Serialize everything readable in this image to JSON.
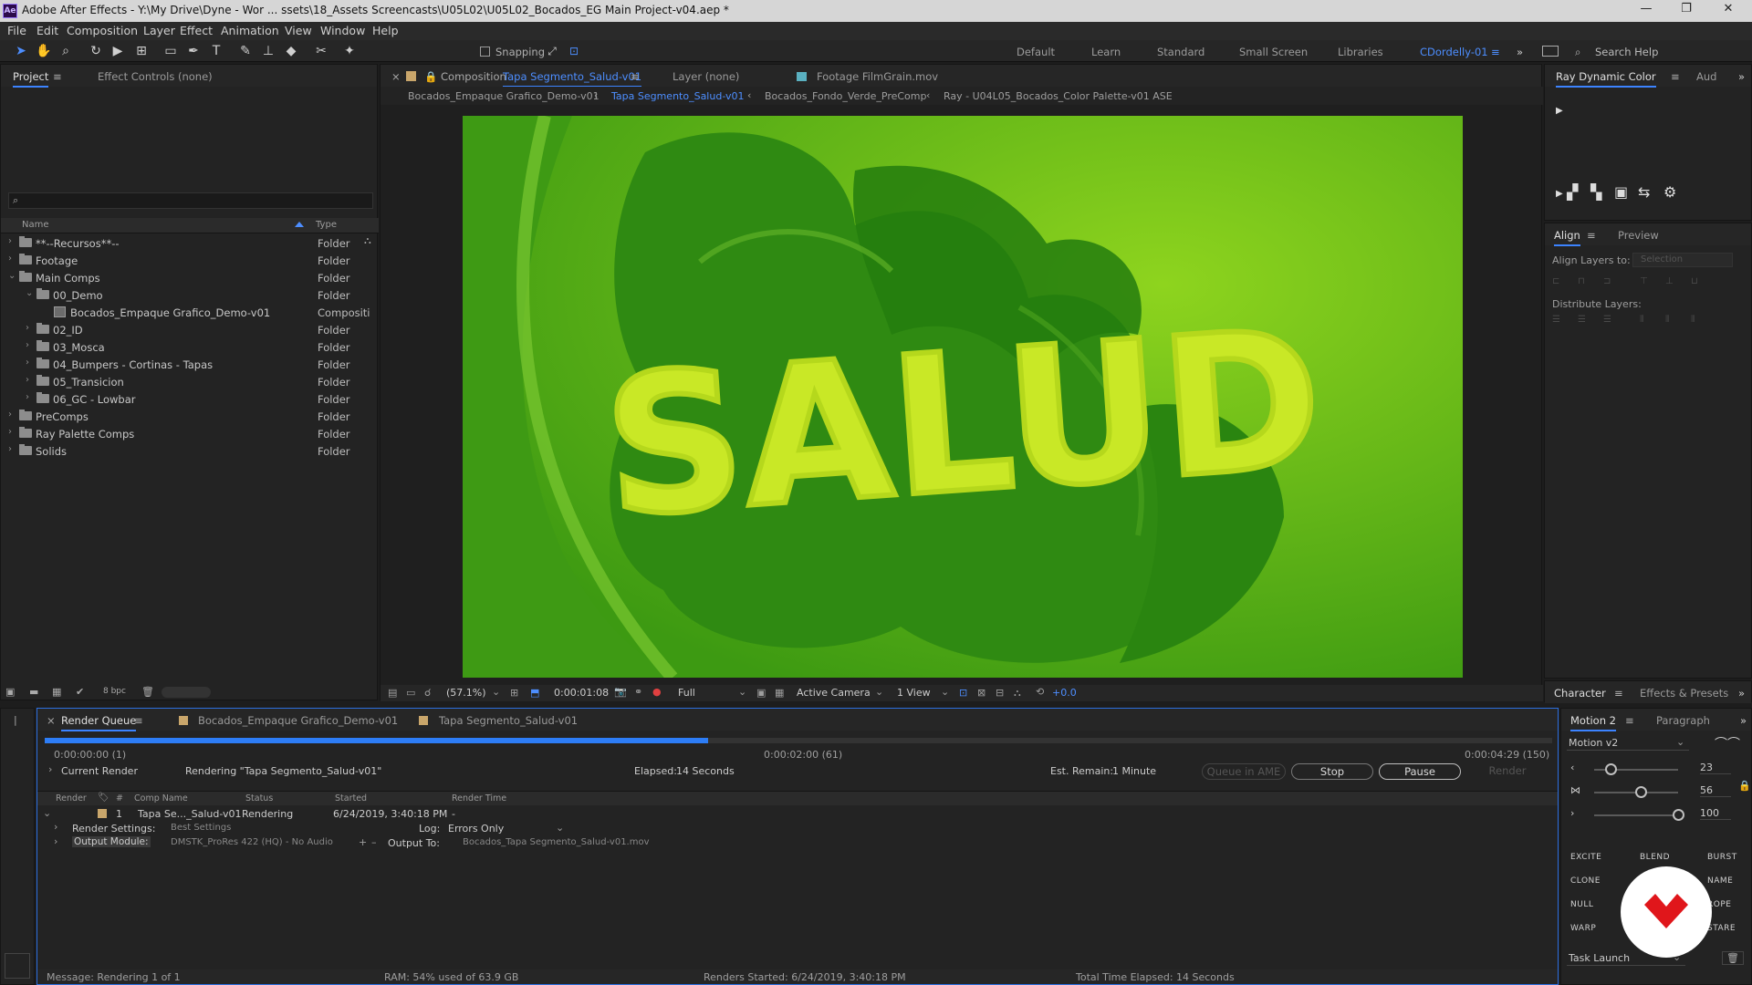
{
  "app": {
    "title": "Adobe After Effects - Y:\\My Drive\\Dyne - Wor ... ssets\\18_Assets Screencasts\\U05L02\\U05L02_Bocados_EG Main Project-v04.aep *",
    "logo": "Ae"
  },
  "menu": [
    "File",
    "Edit",
    "Composition",
    "Layer",
    "Effect",
    "Animation",
    "View",
    "Window",
    "Help"
  ],
  "toolbar": {
    "snapping": "Snapping",
    "workspaces": [
      "Default",
      "Learn",
      "Standard",
      "Small Screen",
      "Libraries",
      "CDordelly-01"
    ],
    "search": "Search Help"
  },
  "project": {
    "tabs": [
      "Project",
      "Effect Controls (none)"
    ],
    "columns": {
      "name": "Name",
      "type": "Type"
    },
    "bpc": "8 bpc",
    "items": [
      {
        "name": "**--Recursos**--",
        "type": "Folder",
        "indent": 0,
        "open": false,
        "kind": "folder"
      },
      {
        "name": "Footage",
        "type": "Folder",
        "indent": 0,
        "open": false,
        "kind": "folder"
      },
      {
        "name": "Main Comps",
        "type": "Folder",
        "indent": 0,
        "open": true,
        "kind": "folder"
      },
      {
        "name": "00_Demo",
        "type": "Folder",
        "indent": 1,
        "open": true,
        "kind": "folder"
      },
      {
        "name": "Bocados_Empaque Grafico_Demo-v01",
        "type": "Compositi",
        "indent": 2,
        "open": null,
        "kind": "comp"
      },
      {
        "name": "02_ID",
        "type": "Folder",
        "indent": 1,
        "open": false,
        "kind": "folder"
      },
      {
        "name": "03_Mosca",
        "type": "Folder",
        "indent": 1,
        "open": false,
        "kind": "folder"
      },
      {
        "name": "04_Bumpers - Cortinas - Tapas",
        "type": "Folder",
        "indent": 1,
        "open": false,
        "kind": "folder"
      },
      {
        "name": "05_Transicion",
        "type": "Folder",
        "indent": 1,
        "open": false,
        "kind": "folder"
      },
      {
        "name": "06_GC - Lowbar",
        "type": "Folder",
        "indent": 1,
        "open": false,
        "kind": "folder"
      },
      {
        "name": "PreComps",
        "type": "Folder",
        "indent": 0,
        "open": false,
        "kind": "folder"
      },
      {
        "name": "Ray Palette Comps",
        "type": "Folder",
        "indent": 0,
        "open": false,
        "kind": "folder"
      },
      {
        "name": "Solids",
        "type": "Folder",
        "indent": 0,
        "open": false,
        "kind": "folder"
      }
    ]
  },
  "viewer": {
    "tab_comp_prefix": "Composition",
    "tab_comp_name": "Tapa Segmento_Salud-v01",
    "tab_layer": "Layer (none)",
    "tab_footage": "Footage FilmGrain.mov",
    "breadcrumbs": [
      "Bocados_Empaque Grafico_Demo-v01",
      "Tapa Segmento_Salud-v01",
      "Bocados_Fondo_Verde_PreComp",
      "Ray - U04L05_Bocados_Color Palette-v01 ASE"
    ],
    "artwork_text": "SALUD",
    "zoom": "(57.1%)",
    "timecode": "0:00:01:08",
    "resolution": "Full",
    "camera": "Active Camera",
    "views": "1 View",
    "exposure": "+0.0"
  },
  "right": {
    "ray_tab": "Ray Dynamic Color",
    "aud_tab": "Aud",
    "align_tab": "Align",
    "preview_tab": "Preview",
    "align_to_label": "Align Layers to:",
    "align_to_value": "Selection",
    "distribute_label": "Distribute Layers:",
    "character_tab": "Character",
    "effects_tab": "Effects & Presets"
  },
  "render_queue": {
    "tabs": [
      "Render Queue",
      "Bocados_Empaque Grafico_Demo-v01",
      "Tapa Segmento_Salud-v01"
    ],
    "time_start": "0:00:00:00 (1)",
    "time_mid": "0:00:02:00 (61)",
    "time_end": "0:00:04:29 (150)",
    "progress": 0.44,
    "current_render_label": "Current Render",
    "current_render_value": "Rendering \"Tapa Segmento_Salud-v01\"",
    "elapsed_label": "Elapsed:",
    "elapsed_value": "14 Seconds",
    "remain_label": "Est. Remain:",
    "remain_value": "1 Minute",
    "buttons": {
      "queue_ame": "Queue in AME",
      "stop": "Stop",
      "pause": "Pause",
      "render": "Render"
    },
    "columns": [
      "Render",
      "#",
      "Comp Name",
      "Status",
      "Started",
      "Render Time"
    ],
    "item": {
      "num": "1",
      "comp": "Tapa Se..._Salud-v01",
      "status": "Rendering",
      "started": "6/24/2019, 3:40:18 PM",
      "render_time": "-",
      "settings_label": "Render Settings:",
      "settings_value": "Best Settings",
      "log_label": "Log:",
      "log_value": "Errors Only",
      "output_label": "Output Module:",
      "output_value": "DMSTK_ProRes 422 (HQ) - No Audio",
      "output_to_label": "Output To:",
      "output_to_value": "Bocados_Tapa Segmento_Salud-v01.mov"
    },
    "status": {
      "message": "Message: Rendering 1 of 1",
      "ram": "RAM: 54% used of 63.9 GB",
      "renders_started": "Renders Started: 6/24/2019, 3:40:18 PM",
      "total_elapsed": "Total Time Elapsed: 14 Seconds"
    }
  },
  "motion": {
    "tab": "Motion 2",
    "paragraph_tab": "Paragraph",
    "preset": "Motion v2",
    "values": [
      "23",
      "56",
      "100"
    ],
    "slider_levels": [
      0.2,
      0.55,
      1.0
    ],
    "buttons": [
      "EXCITE",
      "BLEND",
      "BURST",
      "CLONE",
      "NAME",
      "NULL",
      "ROPE",
      "WARP",
      "STARE"
    ],
    "task": "Task Launch"
  },
  "colors": {
    "accent": "#3c83ff",
    "progress": "#2d7df6",
    "badge": "#e0161b"
  }
}
